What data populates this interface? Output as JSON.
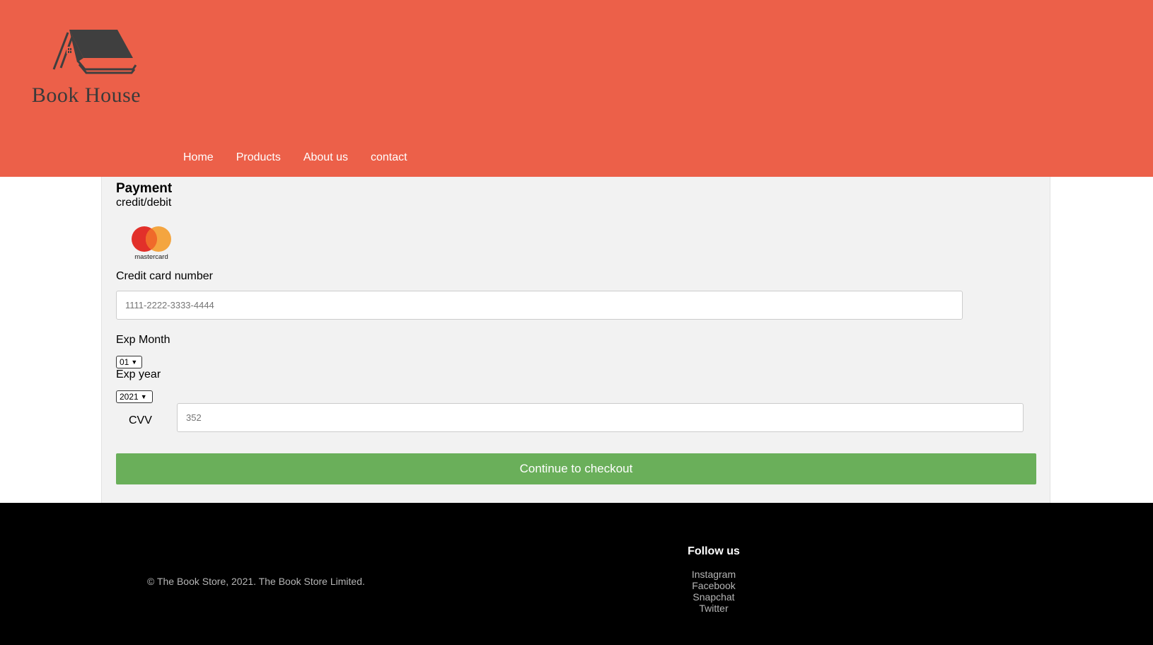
{
  "brand": {
    "name": "Book House",
    "logo_icon": "house-books-icon"
  },
  "nav": {
    "items": [
      {
        "label": "Home"
      },
      {
        "label": "Products"
      },
      {
        "label": "About us"
      },
      {
        "label": "contact"
      }
    ]
  },
  "payment": {
    "title": "Payment",
    "subtitle": "credit/debit",
    "card_logo": {
      "icon": "mastercard-icon",
      "text": "mastercard"
    },
    "card_number": {
      "label": "Credit card number",
      "placeholder": "1111-2222-3333-4444"
    },
    "exp_month": {
      "label": "Exp Month",
      "value": "01"
    },
    "exp_year": {
      "label": "Exp year",
      "value": "2021"
    },
    "cvv": {
      "label": "CVV",
      "placeholder": "352"
    },
    "submit_label": "Continue to checkout"
  },
  "footer": {
    "copyright": "© The Book Store, 2021. The Book Store Limited.",
    "follow_title": "Follow us",
    "social": [
      {
        "label": "Instagram"
      },
      {
        "label": "Facebook"
      },
      {
        "label": "Snapchat"
      },
      {
        "label": "Twitter"
      }
    ]
  },
  "colors": {
    "header_bg": "#ec6049",
    "button_bg": "#6aaf5a",
    "panel_bg": "#f2f2f2",
    "footer_bg": "#000000"
  }
}
